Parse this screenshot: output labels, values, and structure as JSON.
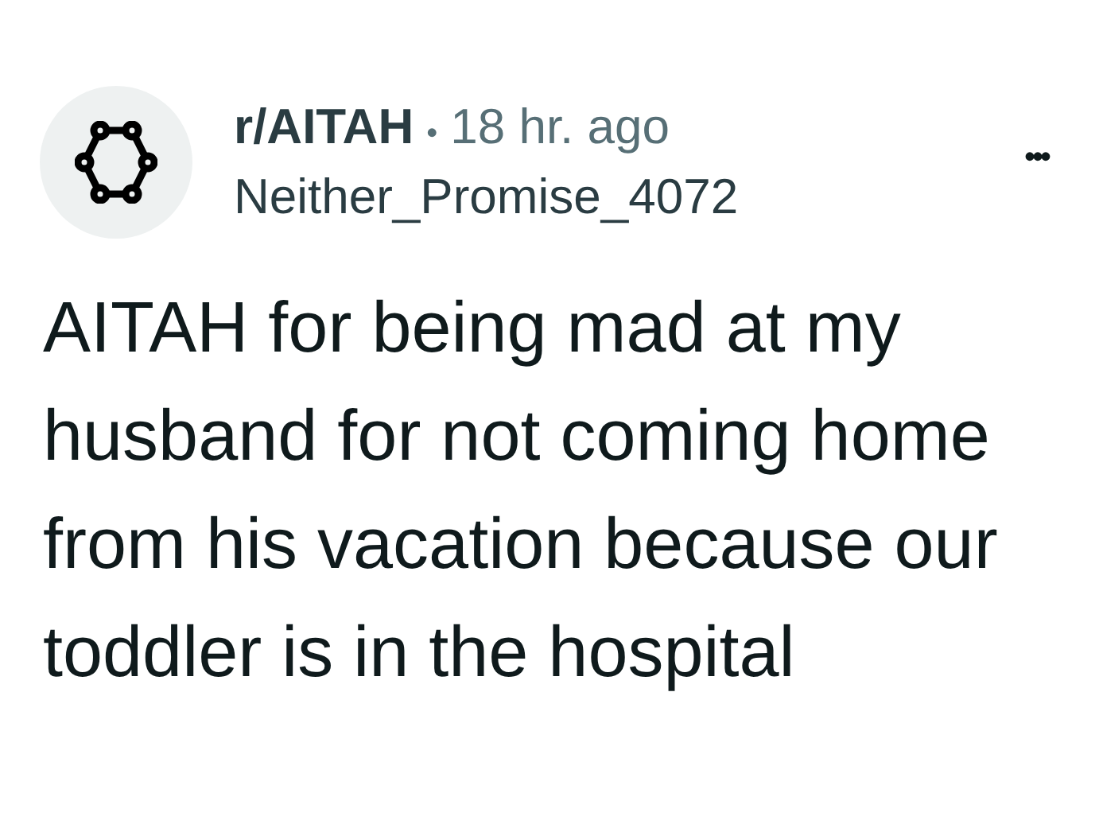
{
  "post": {
    "community": "r/AITAH",
    "separator": "•",
    "time": "18 hr. ago",
    "author": "Neither_Promise_4072",
    "more": "•••",
    "title": "AITAH for being mad at my husband for not coming home from his vacation because our toddler is in the hospital"
  }
}
